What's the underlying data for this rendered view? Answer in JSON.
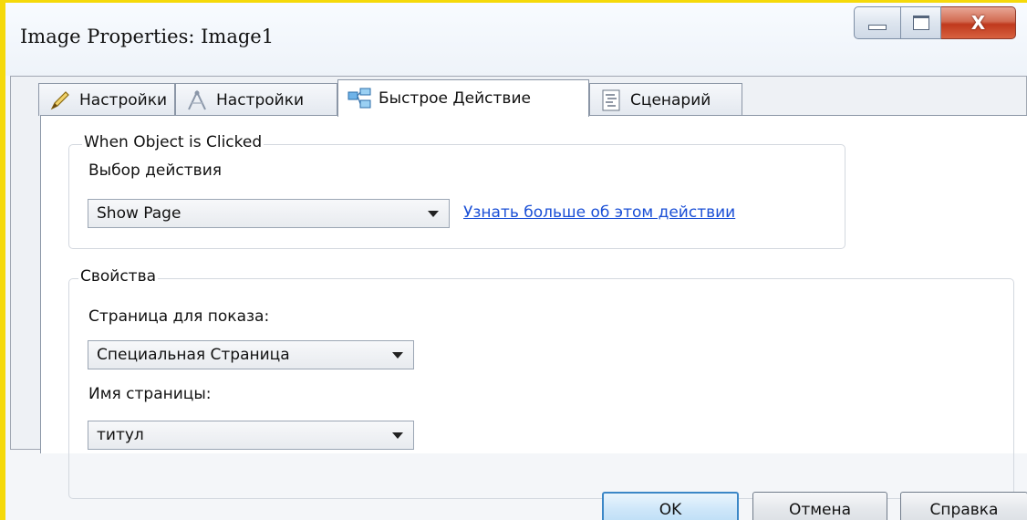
{
  "window": {
    "title": "Image Properties: Image1",
    "controls": [
      "minimize",
      "maximize",
      "close"
    ],
    "close_glyph": "X"
  },
  "tabs": [
    {
      "label": "Настройки",
      "icon": "pencil-icon"
    },
    {
      "label": "Настройки",
      "icon": "compass-icon"
    },
    {
      "label": "Быстрое Действие",
      "icon": "quick-action-icon",
      "active": true
    },
    {
      "label": "Сценарий",
      "icon": "script-icon"
    }
  ],
  "click_group": {
    "legend": "When Object is Clicked",
    "action_label": "Выбор действия",
    "action_value": "Show Page",
    "learn_more_link": "Узнать больше об этом действии"
  },
  "props_group": {
    "legend": "Свойства",
    "page_label": "Страница для показа:",
    "page_value": "Специальная Страница",
    "name_label": "Имя страницы:",
    "name_value": "титул"
  },
  "buttons": {
    "ok": "OK",
    "cancel": "Отмена",
    "help": "Справка"
  },
  "colors": {
    "link": "#1a4fd6",
    "close_button": "#c0391d",
    "frame_highlight": "#f5d90a"
  }
}
